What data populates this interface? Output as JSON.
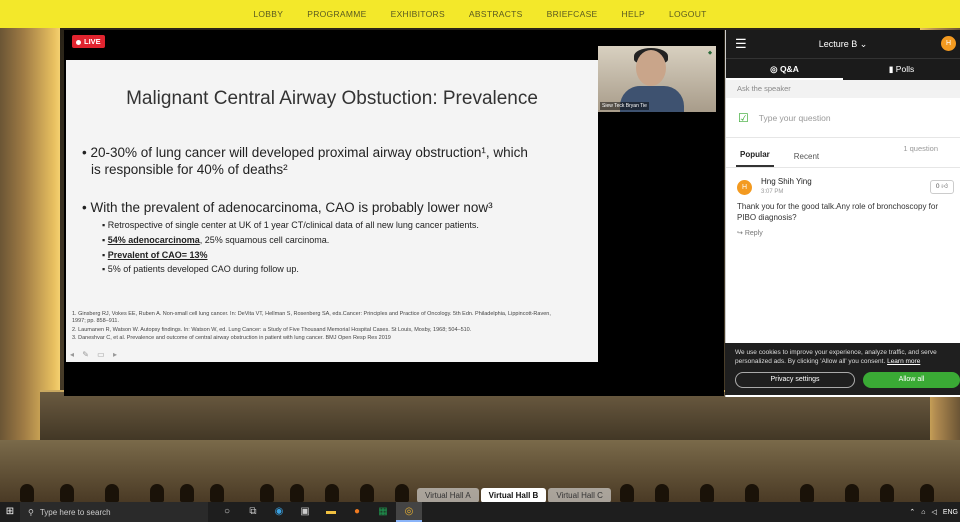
{
  "nav": {
    "items": [
      "LOBBY",
      "PROGRAMME",
      "EXHIBITORS",
      "ABSTRACTS",
      "BRIEFCASE",
      "HELP",
      "LOGOUT"
    ]
  },
  "live_label": "LIVE",
  "slide": {
    "title": "Malignant Central Airway Obstuction: Prevalence",
    "bullet1_line1": "• 20-30% of lung cancer will developed proximal airway obstruction¹, which",
    "bullet1_line2": "is responsible for 40% of deaths²",
    "bullet2": "• With the prevalent of adenocarcinoma, CAO is probably lower now³",
    "sub1": "Retrospective of single center at UK of 1 year CT/clinical data of all new lung cancer patients.",
    "sub2_bold": "54% adenocarcinoma",
    "sub2_rest": ", 25% squamous cell carcinoma.",
    "sub3": "Prevalent of CAO= 13%",
    "sub4": "5% of patients developed CAO during follow up.",
    "ref1": "1.    Ginsberg RJ, Vokes EE, Ruben A. Non-small cell lung cancer. In: DeVita VT, Hellman S, Rosenberg SA, eds.Cancer: Principles and Practice of Oncology. 5th Edn. Philadelphia, Lippincott-Raven,",
    "ref1b": "       1997; pp. 858–911.",
    "ref2": "2.    Laumanen R, Watson W. Autopsy findings. In: Watson W, ed. Lung Cancer: a Study of Five Thousand Memorial Hospital Cases. St Louis, Mosby, 1968; 504–510.",
    "ref3": "3.    Daneshvar C, et al. Prevalence and outcome of central airway obstruction in patient with lung cancer. BMJ Open Resp Res 2019"
  },
  "camera": {
    "name": "Siew Teck Bryan Tie"
  },
  "panel": {
    "title": "Lecture B ⌄",
    "avatar": "H",
    "tab_qa": "Q&A",
    "tab_polls": "Polls",
    "ask_label": "Ask the speaker",
    "question_placeholder": "Type your question",
    "filter_popular": "Popular",
    "filter_recent": "Recent",
    "question_count": "1 question",
    "question": {
      "avatar": "H",
      "name": "Hng Shih Ying",
      "time": "3:07 PM",
      "likes": "0",
      "text": "Thank you for the good talk.Any role of bronchoscopy for PIBO diagnosis?",
      "reply": "Reply"
    }
  },
  "cookie": {
    "text": "We use cookies to improve your experience, analyze traffic, and serve personalized ads. By clicking 'Allow all' you consent.",
    "learn": "Learn more",
    "privacy_button": "Privacy settings",
    "allow_button": "Allow all"
  },
  "halls": [
    "Virtual Hall A",
    "Virtual Hall B",
    "Virtual Hall C"
  ],
  "taskbar": {
    "search_placeholder": "Type here to search",
    "lang": "ENG"
  }
}
